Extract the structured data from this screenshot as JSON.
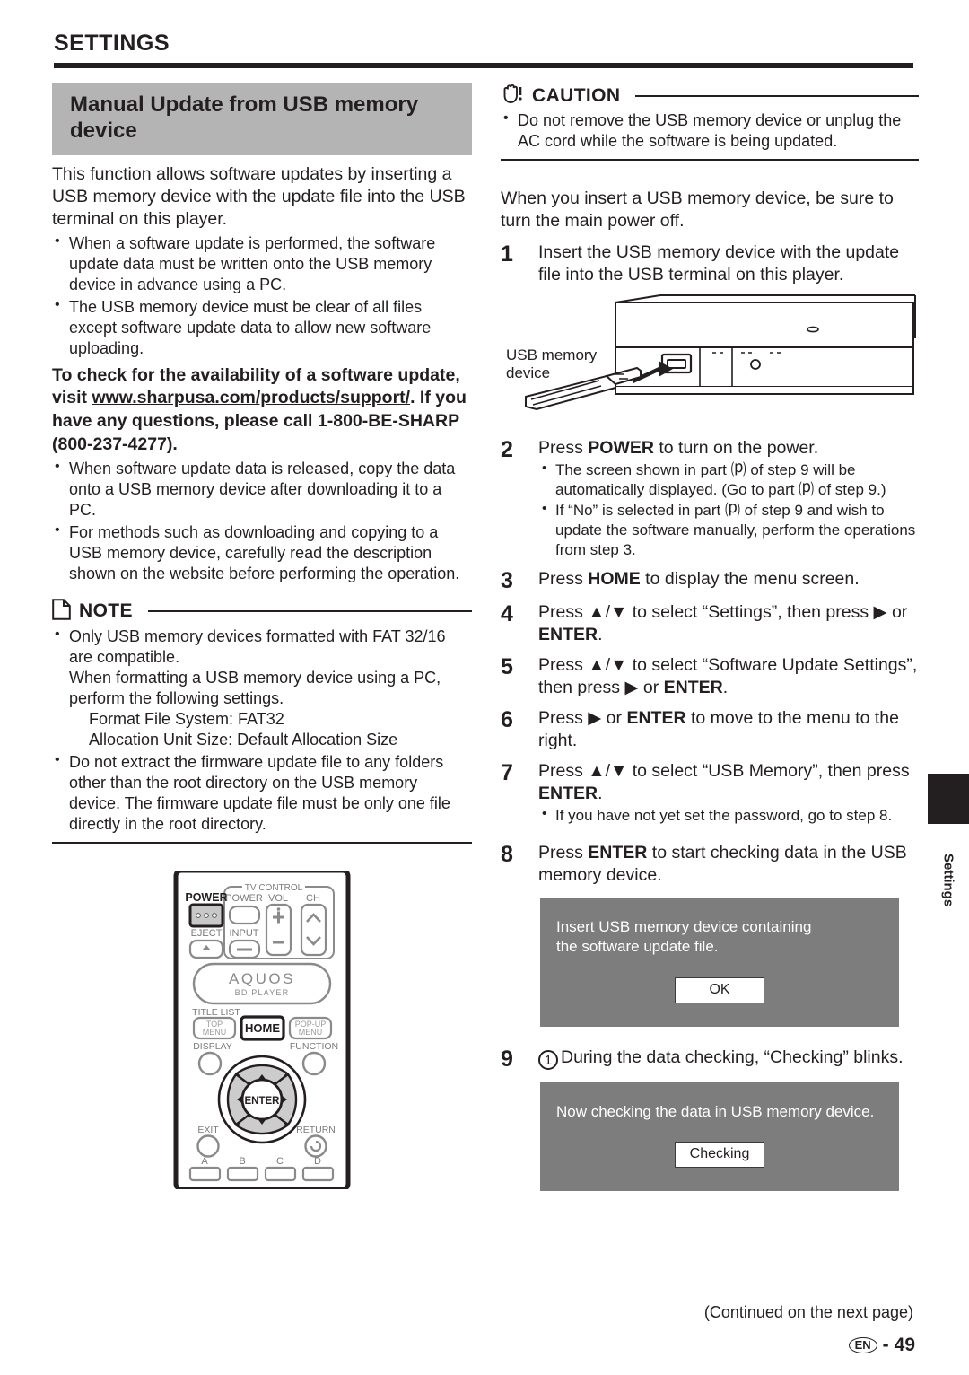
{
  "page": {
    "section_title": "SETTINGS",
    "headline": "Manual Update from USB memory device",
    "footer_continued": "(Continued on the next page)",
    "footer_lang": "EN",
    "footer_dash": "-",
    "footer_page_number": "49",
    "side_tab_label": "Settings",
    "colors": {
      "banner_gray": "#b4b4b4",
      "osd_gray": "#7d7d7d",
      "ink": "#231f20"
    }
  },
  "left": {
    "intro": "This function allows software updates by inserting a USB memory device with the update file into the USB terminal on this player.",
    "intro_bullets": [
      "When a software update is performed, the software update data must be written onto the USB memory device in advance using a PC.",
      "The USB memory device must be clear of all files except software update data to allow new software uploading."
    ],
    "bold_notice": {
      "part1": "To check for the availability of a software update, visit ",
      "url": "www.sharpusa.com/products/support/",
      "part2": ". If you have any questions, please call 1-800-BE-SHARP (800-237-4277)."
    },
    "post_bullets": [
      "When software update data is released, copy the data onto a USB memory device after downloading it to a PC.",
      "For methods such as downloading and copying to a USB memory device, carefully read the description shown on the website before performing the operation."
    ],
    "note": {
      "label": "NOTE",
      "icon": "note-page-icon",
      "items": [
        {
          "text": "Only USB memory devices formatted with FAT 32/16 are compatible.",
          "extra": "When formatting a USB memory device using a PC, perform the following settings.",
          "indented": [
            "Format File System: FAT32",
            "Allocation Unit Size: Default Allocation Size"
          ]
        },
        {
          "text": "Do not extract the firmware update file to any folders other than the root directory on the USB memory device. The firmware update file must be only one file directly in the root directory.",
          "extra": "",
          "indented": []
        }
      ]
    },
    "remote": {
      "power_label": "POWER",
      "eject_label": "EJECT",
      "tv_control_label": "TV CONTROL",
      "tv_power_label": "POWER",
      "tv_vol_label": "VOL",
      "tv_ch_label": "CH",
      "tv_input_label": "INPUT",
      "vol_plus": "+",
      "vol_minus": "−",
      "brand": "AQUOS",
      "brand_sub": "BD PLAYER",
      "title_list_label": "TITLE LIST",
      "top_menu_line1": "TOP",
      "top_menu_line2": "MENU",
      "home_label": "HOME",
      "popup_line1": "POP-UP",
      "popup_line2": "MENU",
      "display_label": "DISPLAY",
      "function_label": "FUNCTION",
      "enter_label": "ENTER",
      "exit_label": "EXIT",
      "return_label": "RETURN",
      "color_keys": [
        "A",
        "B",
        "C",
        "D"
      ]
    }
  },
  "right": {
    "caution": {
      "label": "CAUTION",
      "icon": "hand-caution-icon",
      "items": [
        "Do not remove the USB memory device or unplug the AC cord while the software is being updated."
      ]
    },
    "intro": "When you insert a USB memory device, be sure to turn the main power off.",
    "usb_illustration": {
      "caption_line1": "USB memory",
      "caption_line2": "device"
    },
    "steps": [
      {
        "num": "1",
        "text": "Insert the USB memory device with the update file into the USB terminal on this player.",
        "bold_words": [],
        "substeps": []
      },
      {
        "num": "2",
        "text": "Press POWER to turn on the power.",
        "bold_words": [
          "POWER"
        ],
        "substeps": [
          "The screen shown in part ⒫ of step 9 will be automatically displayed. (Go to part ⒫ of step 9.)",
          "If “No” is selected in part ⒫ of step 9 and wish to update the software manually, perform the operations from step 3."
        ]
      },
      {
        "num": "3",
        "text": "Press HOME to display the menu screen.",
        "bold_words": [
          "HOME"
        ],
        "substeps": []
      },
      {
        "num": "4",
        "text": "Press ▲/▼ to select “Settings”, then press ▶ or ENTER.",
        "bold_words": [
          "ENTER"
        ],
        "substeps": []
      },
      {
        "num": "5",
        "text": "Press ▲/▼ to select “Software Update Settings”, then press ▶ or ENTER.",
        "bold_words": [
          "ENTER"
        ],
        "substeps": []
      },
      {
        "num": "6",
        "text": "Press ▶ or ENTER to move to the menu to the right.",
        "bold_words": [
          "ENTER"
        ],
        "substeps": []
      },
      {
        "num": "7",
        "text": "Press ▲/▼ to select “USB Memory”, then press ENTER.",
        "bold_words": [
          "ENTER"
        ],
        "substeps": [
          "If you have not yet set the password, go to step 8."
        ]
      },
      {
        "num": "8",
        "text": "Press ENTER to start checking data in the USB memory device.",
        "bold_words": [
          "ENTER"
        ],
        "substeps": []
      },
      {
        "num": "9",
        "text": "① During the data checking, “Checking” blinks.",
        "bold_words": [],
        "substeps": []
      }
    ],
    "dialogs": [
      {
        "message_line1": "Insert USB memory device containing",
        "message_line2": "the software update file.",
        "button": "OK"
      },
      {
        "message_line1": "Now checking the data in USB memory device.",
        "message_line2": "",
        "button": "Checking"
      }
    ]
  }
}
